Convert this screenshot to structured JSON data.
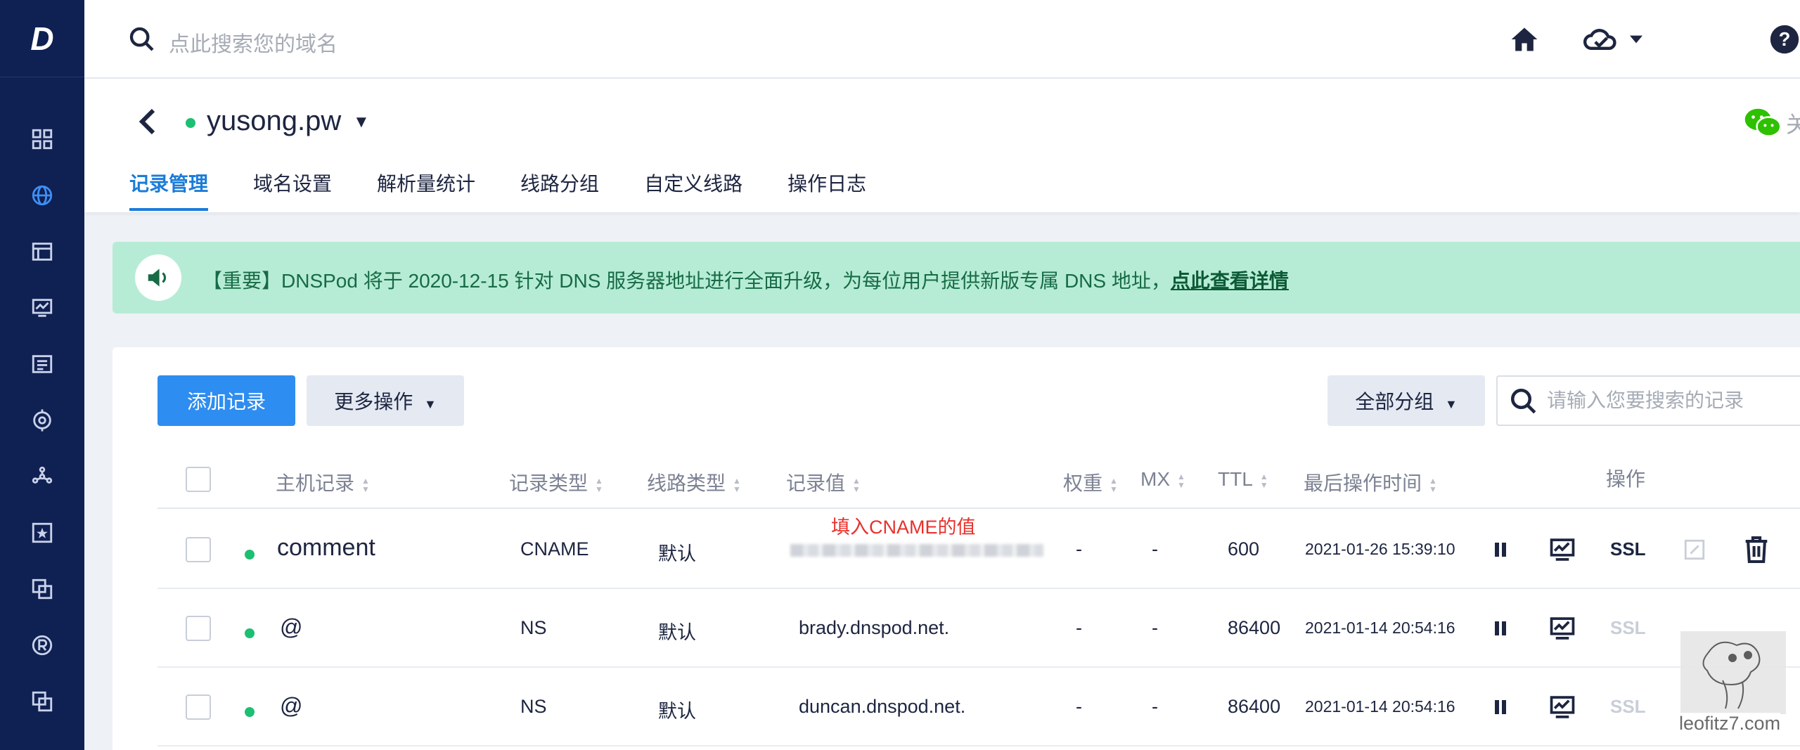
{
  "sidebar": {
    "logo": "D",
    "icons": [
      "dashboard-icon",
      "globe-icon",
      "window-icon",
      "monitor-chart-icon",
      "document-icon",
      "target-icon",
      "network-icon",
      "star-badge-icon",
      "copy-icon",
      "registered-icon",
      "copy-icon"
    ]
  },
  "topbar": {
    "search_placeholder": "点此搜索您的域名"
  },
  "domain": {
    "name": "yusong.pw",
    "status_color": "#1dbf73",
    "wechat_text": "关"
  },
  "tabs": [
    {
      "label": "记录管理",
      "active": true
    },
    {
      "label": "域名设置"
    },
    {
      "label": "解析量统计"
    },
    {
      "label": "线路分组"
    },
    {
      "label": "自定义线路"
    },
    {
      "label": "操作日志"
    }
  ],
  "notice": {
    "text": "【重要】DNSPod 将于 2020-12-15 针对 DNS 服务器地址进行全面升级，为每位用户提供新版专属 DNS 地址，",
    "link": "点此查看详情"
  },
  "toolbar": {
    "add_label": "添加记录",
    "more_label": "更多操作",
    "group_label": "全部分组",
    "search_placeholder": "请输入您要搜索的记录"
  },
  "table": {
    "headers": {
      "host": "主机记录",
      "type": "记录类型",
      "line": "线路类型",
      "value": "记录值",
      "weight": "权重",
      "mx": "MX",
      "ttl": "TTL",
      "time": "最后操作时间",
      "ops": "操作"
    },
    "annotation": "填入CNAME的值",
    "rows": [
      {
        "host": "comment",
        "type": "CNAME",
        "line": "默认",
        "value": "",
        "weight": "-",
        "mx": "-",
        "ttl": "600",
        "time": "2021-01-26 15:39:10",
        "ssl": "SSL"
      },
      {
        "host": "@",
        "type": "NS",
        "line": "默认",
        "value": "brady.dnspod.net.",
        "weight": "-",
        "mx": "-",
        "ttl": "86400",
        "time": "2021-01-14 20:54:16",
        "ssl": "SSL"
      },
      {
        "host": "@",
        "type": "NS",
        "line": "默认",
        "value": "duncan.dnspod.net.",
        "weight": "-",
        "mx": "-",
        "ttl": "86400",
        "time": "2021-01-14 20:54:16",
        "ssl": "SSL"
      }
    ]
  },
  "watermark": "leofitz7.com",
  "colors": {
    "sidebar": "#0f2052",
    "accent": "#1b7cd9",
    "primary_button": "#2e8df0",
    "notice_bg": "#b6ecd5",
    "status_green": "#1dbf73",
    "annotation_red": "#e8302a"
  }
}
